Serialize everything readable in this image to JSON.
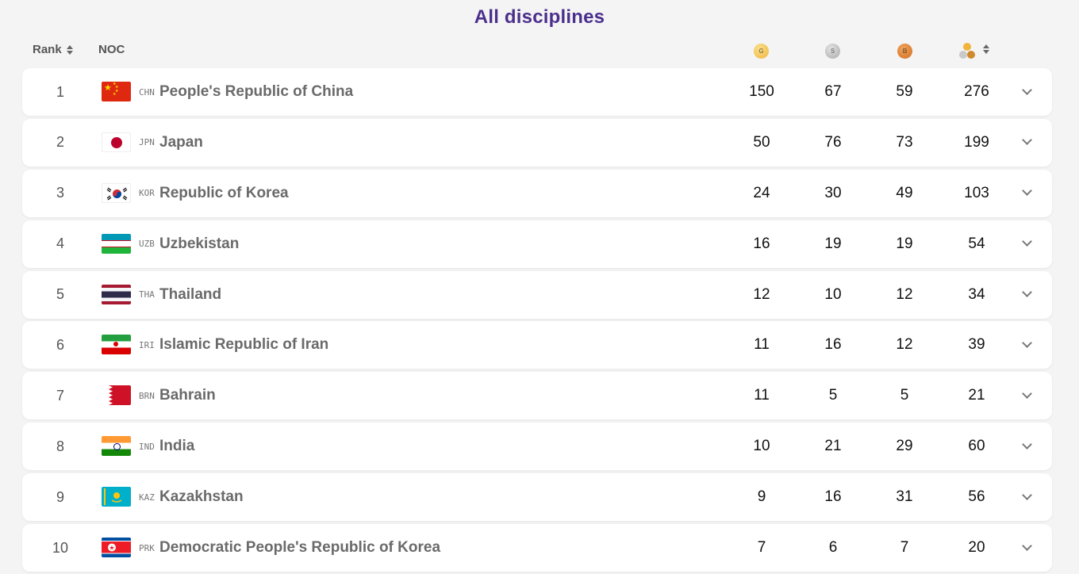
{
  "page": {
    "title": "All disciplines"
  },
  "header": {
    "rank_label": "Rank",
    "noc_label": "NOC",
    "gold_letter": "G",
    "silver_letter": "S",
    "bronze_letter": "B"
  },
  "rows": [
    {
      "rank": "1",
      "code": "CHN",
      "country": "People's Republic of China",
      "gold": "150",
      "silver": "67",
      "bronze": "59",
      "total": "276"
    },
    {
      "rank": "2",
      "code": "JPN",
      "country": "Japan",
      "gold": "50",
      "silver": "76",
      "bronze": "73",
      "total": "199"
    },
    {
      "rank": "3",
      "code": "KOR",
      "country": "Republic of Korea",
      "gold": "24",
      "silver": "30",
      "bronze": "49",
      "total": "103"
    },
    {
      "rank": "4",
      "code": "UZB",
      "country": "Uzbekistan",
      "gold": "16",
      "silver": "19",
      "bronze": "19",
      "total": "54"
    },
    {
      "rank": "5",
      "code": "THA",
      "country": "Thailand",
      "gold": "12",
      "silver": "10",
      "bronze": "12",
      "total": "34"
    },
    {
      "rank": "6",
      "code": "IRI",
      "country": "Islamic Republic of Iran",
      "gold": "11",
      "silver": "16",
      "bronze": "12",
      "total": "39"
    },
    {
      "rank": "7",
      "code": "BRN",
      "country": "Bahrain",
      "gold": "11",
      "silver": "5",
      "bronze": "5",
      "total": "21"
    },
    {
      "rank": "8",
      "code": "IND",
      "country": "India",
      "gold": "10",
      "silver": "21",
      "bronze": "29",
      "total": "60"
    },
    {
      "rank": "9",
      "code": "KAZ",
      "country": "Kazakhstan",
      "gold": "9",
      "silver": "16",
      "bronze": "31",
      "total": "56"
    },
    {
      "rank": "10",
      "code": "PRK",
      "country": "Democratic People's Republic of Korea",
      "gold": "7",
      "silver": "6",
      "bronze": "7",
      "total": "20"
    }
  ],
  "colors": {
    "title": "#4b2f8c",
    "gold": "#f0b43a",
    "silver": "#a8a8a8",
    "bronze": "#cf6d1d"
  }
}
